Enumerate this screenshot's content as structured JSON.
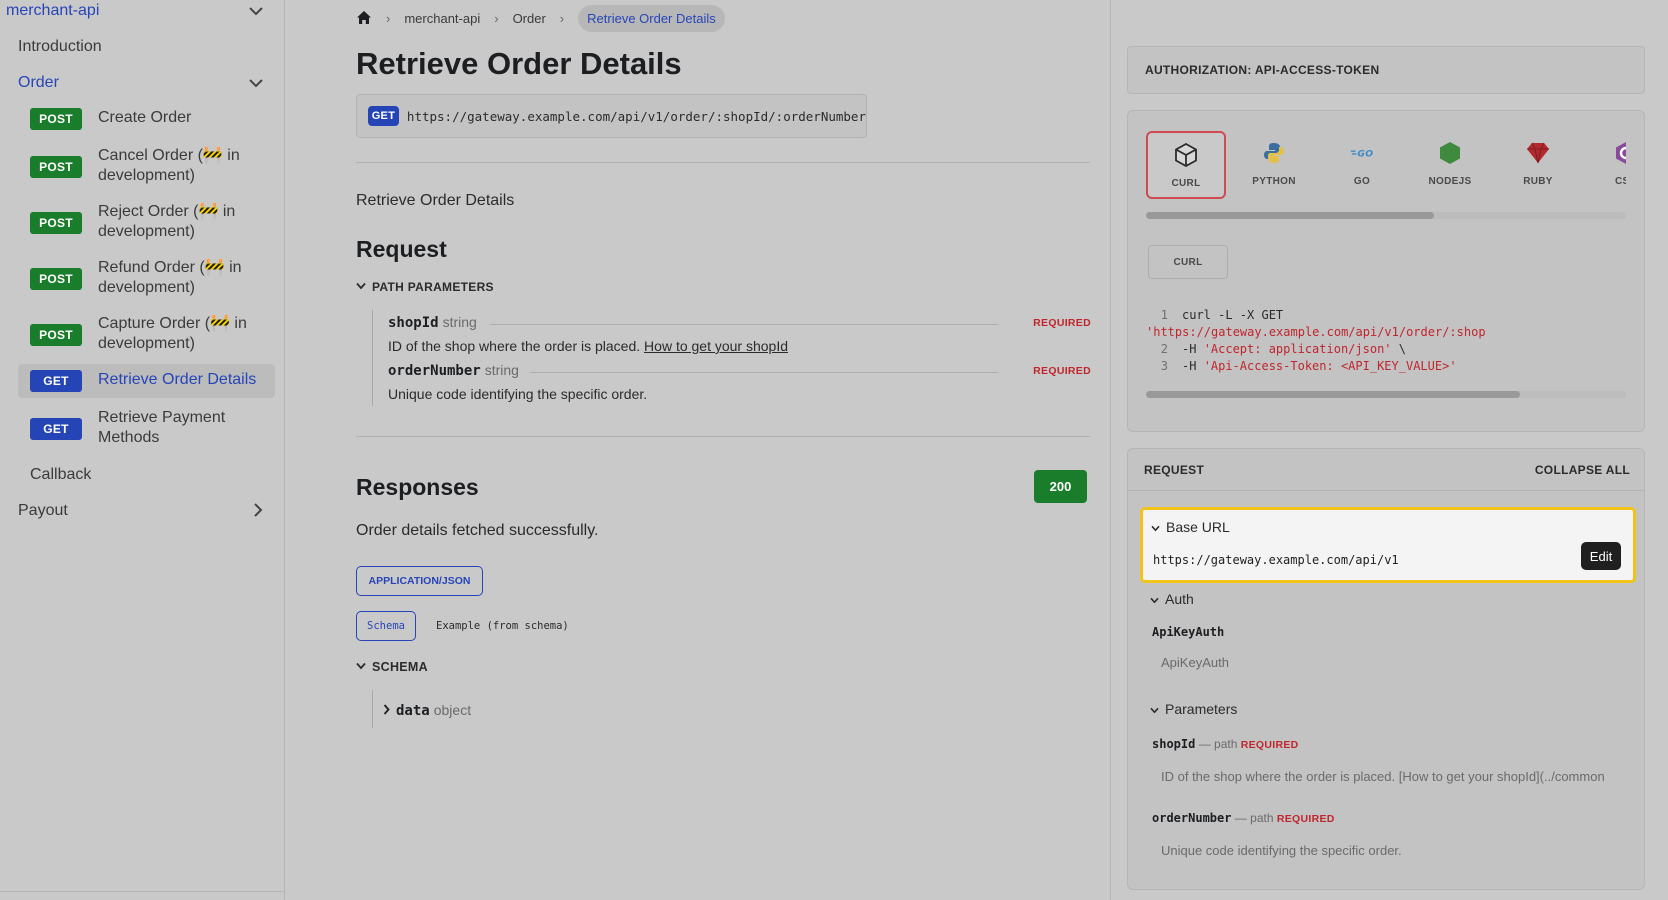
{
  "sidebar": {
    "root": "merchant-api",
    "introduction": "Introduction",
    "order_category": "Order",
    "items": [
      {
        "method": "POST",
        "label": "Create Order"
      },
      {
        "method": "POST",
        "label": "Cancel Order (🚧 in development)"
      },
      {
        "method": "POST",
        "label": "Reject Order (🚧 in development)"
      },
      {
        "method": "POST",
        "label": "Refund Order (🚧 in development)"
      },
      {
        "method": "POST",
        "label": "Capture Order (🚧 in development)"
      },
      {
        "method": "GET",
        "label": "Retrieve Order Details"
      },
      {
        "method": "GET",
        "label": "Retrieve Payment Methods"
      }
    ],
    "callback": "Callback",
    "payout": "Payout"
  },
  "breadcrumb": [
    "merchant-api",
    "Order",
    "Retrieve Order Details"
  ],
  "page": {
    "title": "Retrieve Order Details",
    "method": "GET",
    "url": "https://gateway.example.com/api/v1/order/:shopId/:orderNumber",
    "description": "Retrieve Order Details"
  },
  "request": {
    "heading": "Request",
    "path_params_label": "PATH PARAMETERS",
    "params": [
      {
        "name": "shopId",
        "type": "string",
        "required": "REQUIRED",
        "description": "ID of the shop where the order is placed. ",
        "link": "How to get your shopId"
      },
      {
        "name": "orderNumber",
        "type": "string",
        "required": "REQUIRED",
        "description": "Unique code identifying the specific order."
      }
    ]
  },
  "responses": {
    "heading": "Responses",
    "status": "200",
    "description": "Order details fetched successfully.",
    "content_type": "APPLICATION/JSON",
    "schema_tab": "Schema",
    "example_tab": "Example (from schema)",
    "schema_label": "SCHEMA",
    "field_name": "data",
    "field_type": "object"
  },
  "right": {
    "auth_label": "AUTHORIZATION: API-ACCESS-TOKEN",
    "languages": [
      "CURL",
      "PYTHON",
      "GO",
      "NODEJS",
      "RUBY",
      "CSH"
    ],
    "selected_language": "CURL",
    "sub_tab": "CURL",
    "code_lines": [
      {
        "n": "1",
        "parts": [
          [
            "t",
            "curl -L -X GET "
          ],
          [
            "s",
            "'https://gateway.example.com/api/v1/order/:shop"
          ]
        ]
      },
      {
        "n": "2",
        "parts": [
          [
            "t",
            "-H "
          ],
          [
            "s",
            "'Accept: application/json'"
          ],
          [
            "t",
            " \\"
          ]
        ]
      },
      {
        "n": "3",
        "parts": [
          [
            "t",
            "-H "
          ],
          [
            "s",
            "'Api-Access-Token: <API_KEY_VALUE>'"
          ]
        ]
      }
    ],
    "request_label": "REQUEST",
    "collapse_all": "COLLAPSE ALL",
    "base_url_label": "Base URL",
    "base_url": "https://gateway.example.com/api/v1",
    "edit": "Edit",
    "auth_section": "Auth",
    "auth_name": "ApiKeyAuth",
    "auth_value": "ApiKeyAuth",
    "params_section": "Parameters",
    "params": [
      {
        "name": "shopId",
        "meta": " — path ",
        "req": "REQUIRED",
        "hint": "ID of the shop where the order is placed. [How to get your shopId](../common"
      },
      {
        "name": "orderNumber",
        "meta": " — path ",
        "req": "REQUIRED",
        "hint": "Unique code identifying the specific order."
      }
    ]
  }
}
